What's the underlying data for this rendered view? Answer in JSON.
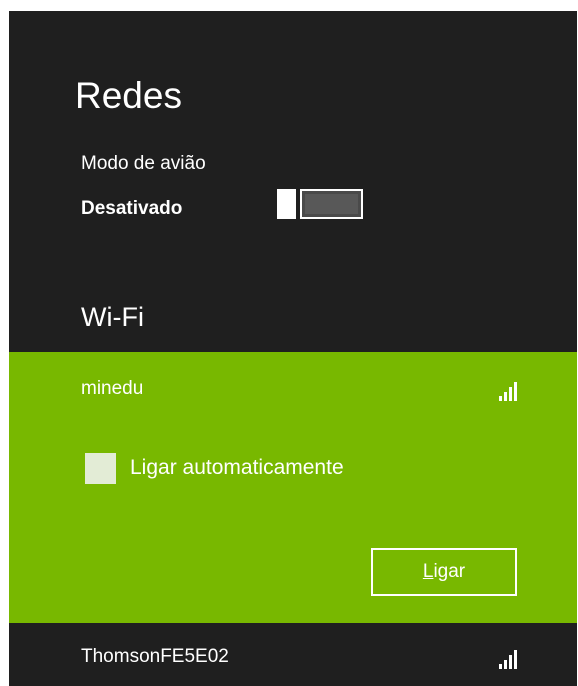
{
  "panel": {
    "title": "Redes"
  },
  "airplane_mode": {
    "label": "Modo de avião",
    "state": "Desativado",
    "enabled": false
  },
  "wifi": {
    "section_title": "Wi-Fi",
    "networks": [
      {
        "name": "minedu",
        "selected": true,
        "signal_bars": 4,
        "connect_automatically_label": "Ligar automaticamente",
        "connect_automatically_checked": false,
        "connect_button": {
          "mnemonic": "L",
          "rest": "igar"
        }
      },
      {
        "name": "ThomsonFE5E02",
        "selected": false,
        "signal_bars": 4
      }
    ]
  },
  "colors": {
    "panel_background": "#1f1f1f",
    "accent": "#78b800",
    "text": "#ffffff"
  },
  "icons": {
    "signal": "wifi-signal-icon"
  }
}
